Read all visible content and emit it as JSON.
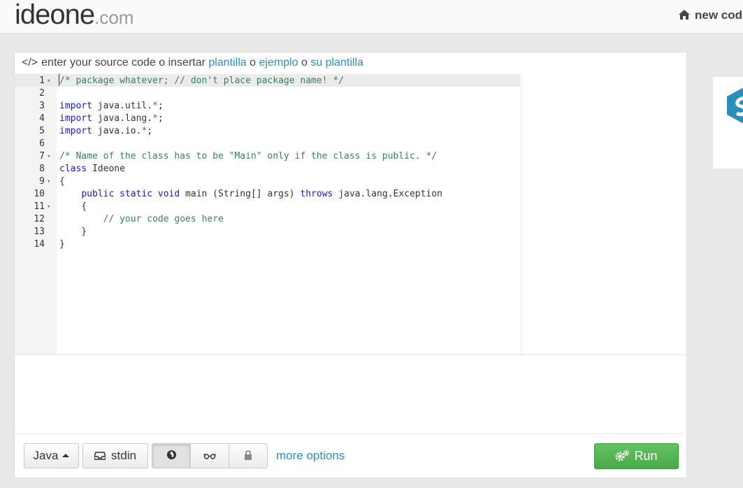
{
  "header": {
    "logo_main": "ideone",
    "logo_domain": ".com",
    "nav_new_code": "new code"
  },
  "panel": {
    "title_prefix": "enter your source code o insertar",
    "link_template": "plantilla",
    "sep1": "o",
    "link_example": "ejemplo",
    "sep2": "o",
    "link_your_template": "su plantilla"
  },
  "editor": {
    "lines": [
      {
        "n": "1",
        "fold": true,
        "text": "/* package whatever; // don't place package name! */"
      },
      {
        "n": "2",
        "fold": false,
        "text": ""
      },
      {
        "n": "3",
        "fold": false,
        "text": "import java.util.*;"
      },
      {
        "n": "4",
        "fold": false,
        "text": "import java.lang.*;"
      },
      {
        "n": "5",
        "fold": false,
        "text": "import java.io.*;"
      },
      {
        "n": "6",
        "fold": false,
        "text": ""
      },
      {
        "n": "7",
        "fold": true,
        "text": "/* Name of the class has to be \"Main\" only if the class is public. */"
      },
      {
        "n": "8",
        "fold": false,
        "text": "class Ideone"
      },
      {
        "n": "9",
        "fold": true,
        "text": "{"
      },
      {
        "n": "10",
        "fold": false,
        "text": "    public static void main (String[] args) throws java.lang.Exception"
      },
      {
        "n": "11",
        "fold": true,
        "text": "    {"
      },
      {
        "n": "12",
        "fold": false,
        "text": "        // your code goes here"
      },
      {
        "n": "13",
        "fold": false,
        "text": "    }"
      },
      {
        "n": "14",
        "fold": false,
        "text": "}"
      }
    ]
  },
  "toolbar": {
    "language": "Java",
    "stdin": "stdin",
    "more_options": "more options",
    "run": "Run",
    "icons": [
      "globe-icon",
      "glasses-icon",
      "lock-icon"
    ]
  }
}
